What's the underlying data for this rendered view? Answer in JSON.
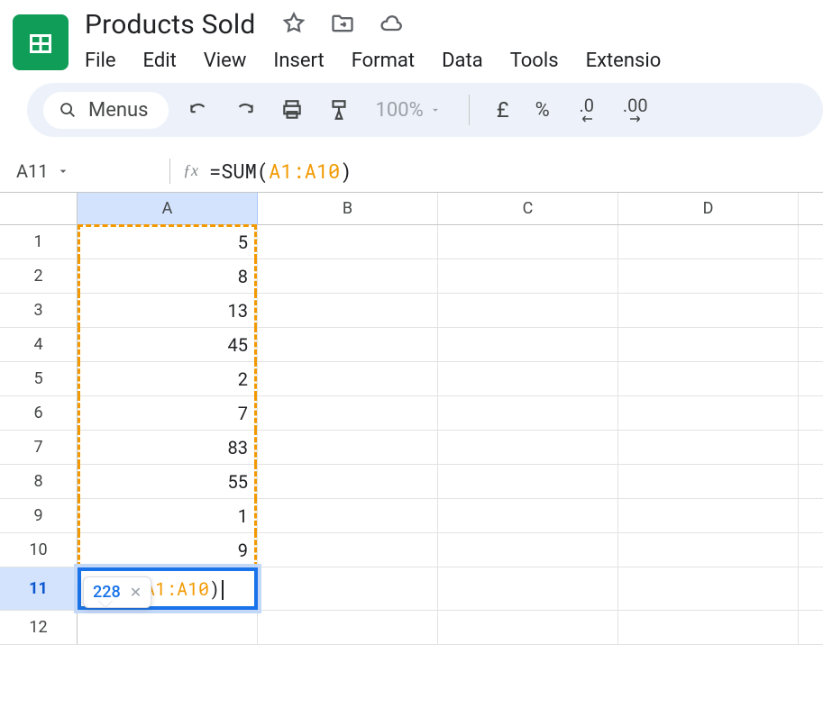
{
  "header": {
    "title": "Products Sold",
    "menus": [
      "File",
      "Edit",
      "View",
      "Insert",
      "Format",
      "Data",
      "Tools",
      "Extensio"
    ]
  },
  "toolbar": {
    "menus_label": "Menus",
    "zoom": "100%",
    "currency": "£",
    "percent": "%",
    "dec_less": ".0",
    "dec_more": ".00"
  },
  "formula_bar": {
    "name_box": "A11",
    "formula_prefix": "=SUM(",
    "formula_range": "A1:A10",
    "formula_suffix": ")"
  },
  "editing": {
    "prefix": "=SUM(",
    "range": "A1:A10",
    "suffix": ")",
    "preview_result": "228"
  },
  "grid": {
    "columns": [
      "A",
      "B",
      "C",
      "D"
    ],
    "rows": [
      "1",
      "2",
      "3",
      "4",
      "5",
      "6",
      "7",
      "8",
      "9",
      "10",
      "11",
      "12"
    ],
    "active_row": "11",
    "values_A": [
      "5",
      "8",
      "13",
      "45",
      "2",
      "7",
      "83",
      "55",
      "1",
      "9"
    ]
  },
  "chart_data": {
    "type": "table",
    "title": "Products Sold",
    "columns": [
      "A"
    ],
    "rows": [
      {
        "row": 1,
        "A": 5
      },
      {
        "row": 2,
        "A": 8
      },
      {
        "row": 3,
        "A": 13
      },
      {
        "row": 4,
        "A": 45
      },
      {
        "row": 5,
        "A": 2
      },
      {
        "row": 6,
        "A": 7
      },
      {
        "row": 7,
        "A": 83
      },
      {
        "row": 8,
        "A": 55
      },
      {
        "row": 9,
        "A": 1
      },
      {
        "row": 10,
        "A": 9
      }
    ],
    "formula_cell": {
      "row": 11,
      "col": "A",
      "formula": "=SUM(A1:A10)",
      "result": 228
    }
  }
}
